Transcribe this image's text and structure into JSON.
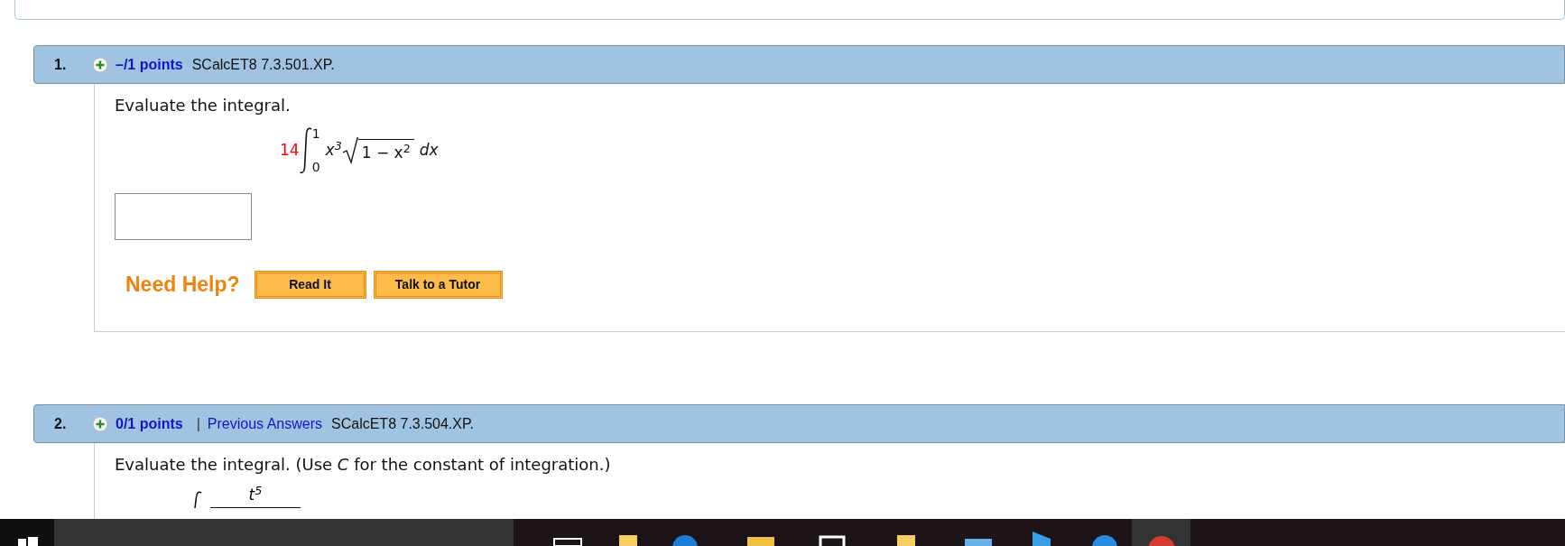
{
  "questions": [
    {
      "number": "1.",
      "points": "–/1 points",
      "code": "SCalcET8 7.3.501.XP.",
      "prompt": "Evaluate the integral.",
      "integral": {
        "coefficient": "14",
        "upper": "1",
        "lower": "0",
        "factor": "x$^{3}$",
        "radicand": "1 − x$^{2}$",
        "differential": "dx"
      },
      "help": {
        "label": "Need Help?",
        "buttons": [
          "Read It",
          "Talk to a Tutor"
        ]
      }
    },
    {
      "number": "2.",
      "points": "0/1 points",
      "separator": "|",
      "previous_answers": "Previous Answers",
      "code": "SCalcET8 7.3.504.XP.",
      "prompt": "Evaluate the integral. (Use *C* for the constant of integration.)",
      "fraction": {
        "numerator": "t$^{5}$"
      }
    }
  ]
}
